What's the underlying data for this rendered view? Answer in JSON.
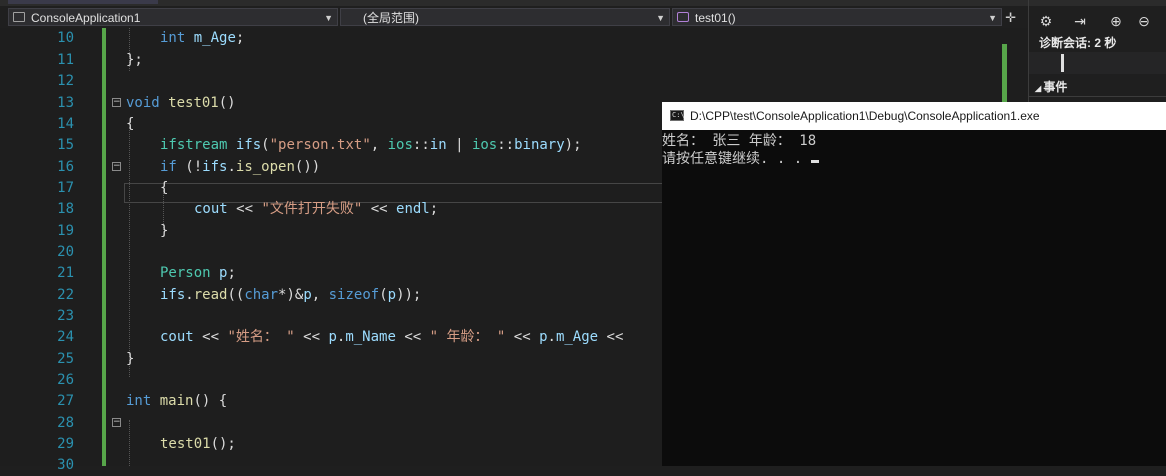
{
  "navbar": {
    "project": "ConsoleApplication1",
    "scope": "(全局范围)",
    "member": "test01()"
  },
  "editor": {
    "line_numbers": [
      "10",
      "11",
      "12",
      "13",
      "14",
      "15",
      "16",
      "17",
      "18",
      "19",
      "20",
      "21",
      "22",
      "23",
      "24",
      "25",
      "26",
      "27",
      "28",
      "29",
      "30"
    ]
  },
  "diagnostics": {
    "session_label": "诊断会话: 2 秒",
    "events_label": "事件"
  },
  "console": {
    "title": "D:\\CPP\\test\\ConsoleApplication1\\Debug\\ConsoleApplication1.exe",
    "line1": "姓名： 张三 年龄： 18",
    "line2": "请按任意键继续. . . ",
    "icon_text": "C:\\"
  },
  "colors": {
    "keyword": "#569cd6",
    "type": "#4ec9b0",
    "string": "#d69d85",
    "function": "#dcdcaa",
    "variable": "#9cdcfe",
    "line_number": "#2b91af",
    "change_bar": "#57a64a"
  },
  "icons": [
    "settings-icon",
    "export-icon",
    "zoom-in-icon",
    "zoom-out-icon",
    "split-icon",
    "console-app-icon"
  ]
}
